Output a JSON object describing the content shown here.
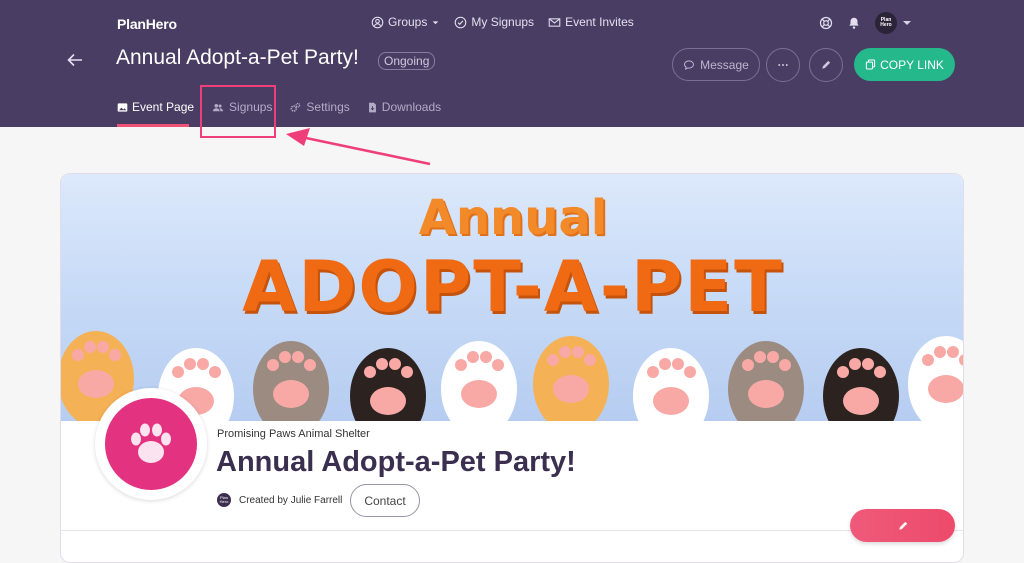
{
  "app": {
    "logo": "PlanHero"
  },
  "topnav": {
    "groups": "Groups",
    "my_signups": "My Signups",
    "event_invites": "Event Invites"
  },
  "user": {
    "avatar_text": "Plan Hero"
  },
  "header": {
    "title": "Annual Adopt-a-Pet Party!",
    "status": "Ongoing",
    "message_label": "Message",
    "copy_link_label": "COPY LINK"
  },
  "tabs": [
    {
      "label": "Event Page",
      "active": true
    },
    {
      "label": "Signups",
      "active": false
    },
    {
      "label": "Settings",
      "active": false
    },
    {
      "label": "Downloads",
      "active": false
    }
  ],
  "banner": {
    "line1": "Annual",
    "line2": "ADOPT-A-PET"
  },
  "event": {
    "organization": "Promising Paws Animal Shelter",
    "title": "Annual Adopt-a-Pet Party!",
    "created_by": "Created by Julie Farrell",
    "contact_label": "Contact"
  },
  "colors": {
    "header_bg": "#4a3d63",
    "accent_green": "#25b88a",
    "accent_pink": "#ef5276",
    "profile_pink": "#e3327f"
  }
}
